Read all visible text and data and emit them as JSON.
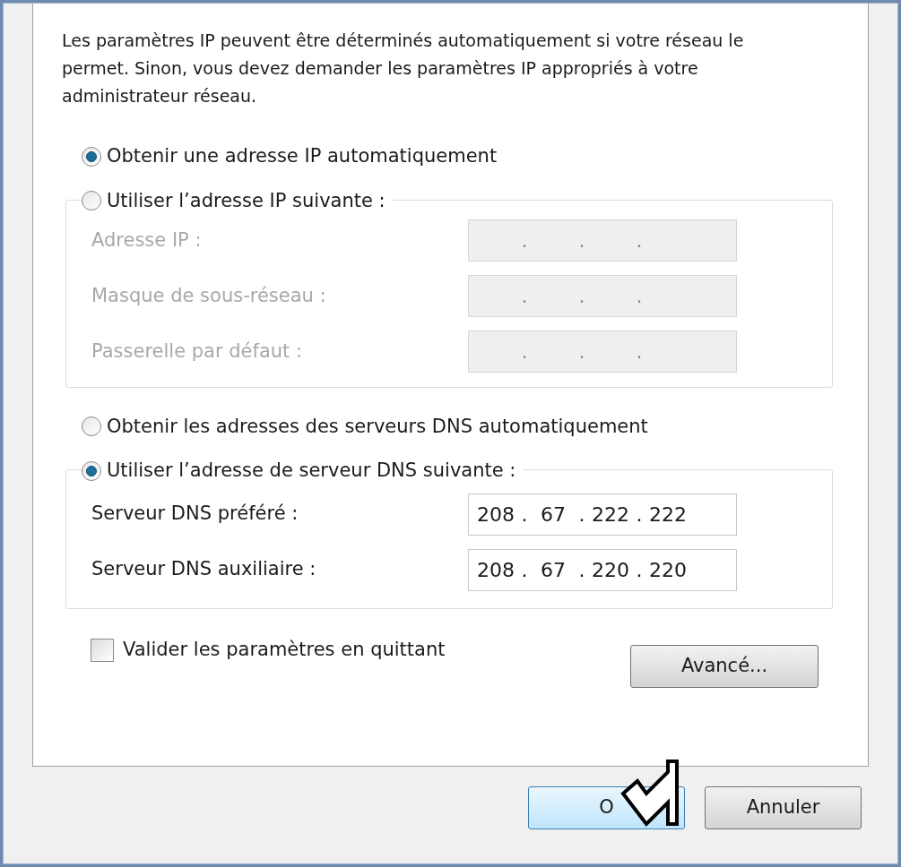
{
  "intro": "Les paramètres IP peuvent être déterminés automatiquement si votre réseau le permet. Sinon, vous devez demander les paramètres IP appropriés à votre administrateur réseau.",
  "separator": ".",
  "ip_mode": [
    {
      "label": "Obtenir une adresse IP automatiquement",
      "selected": true
    },
    {
      "label": "Utiliser l’adresse IP suivante :",
      "selected": false
    }
  ],
  "ip_fields": [
    {
      "label": "Adresse IP :",
      "disabled": true
    },
    {
      "label": "Masque de sous-réseau :",
      "disabled": true
    },
    {
      "label": "Passerelle par défaut :",
      "disabled": true
    }
  ],
  "dns_mode": [
    {
      "label": "Obtenir les adresses des serveurs DNS automatiquement",
      "selected": false
    },
    {
      "label": "Utiliser l’adresse de serveur DNS suivante :",
      "selected": true
    }
  ],
  "dns_fields": [
    {
      "label": "Serveur DNS préféré :",
      "disabled": false,
      "octets": [
        "208",
        "67",
        "222",
        "222"
      ]
    },
    {
      "label": "Serveur DNS auxiliaire :",
      "disabled": false,
      "octets": [
        "208",
        "67",
        "220",
        "220"
      ]
    }
  ],
  "validate": {
    "label": "Valider les paramètres en quittant",
    "checked": false
  },
  "advanced_button": "Avancé...",
  "footer_buttons": [
    {
      "label": "O",
      "default": true
    },
    {
      "label": "Annuler",
      "default": false
    }
  ]
}
